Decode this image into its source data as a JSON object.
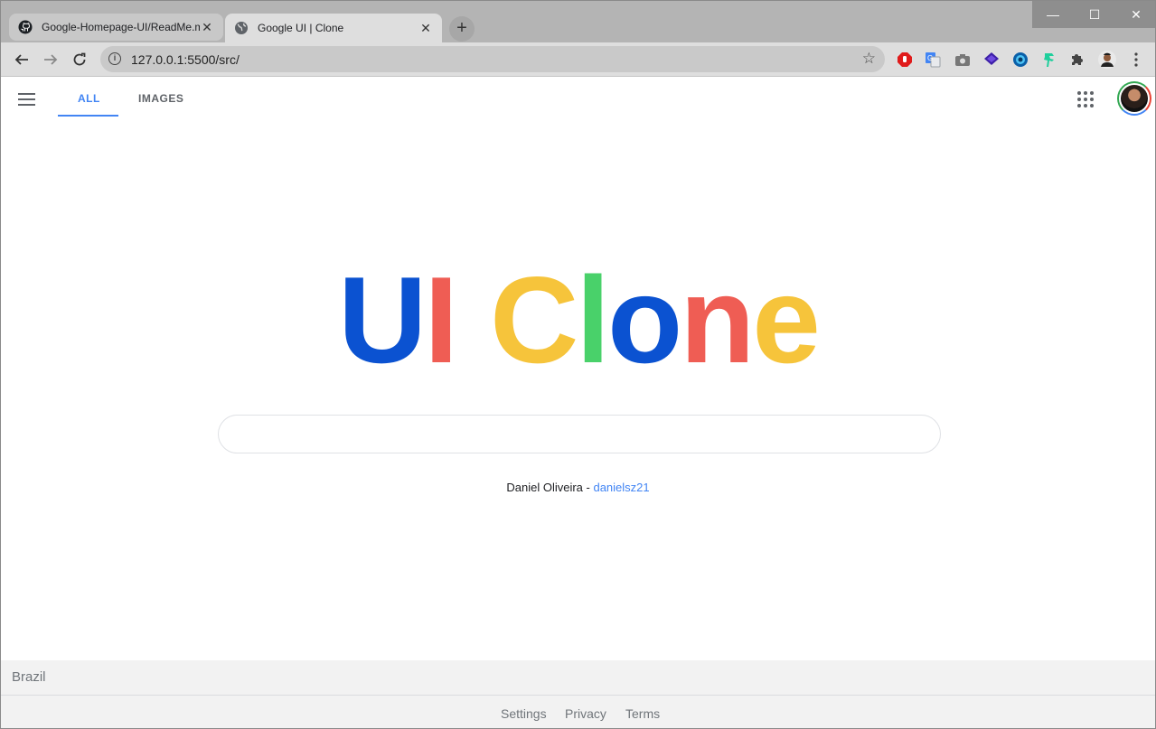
{
  "browser": {
    "tabs": [
      {
        "title": "Google-Homepage-UI/ReadMe.m",
        "close": "✕"
      },
      {
        "title": "Google UI | Clone",
        "close": "✕"
      }
    ],
    "new_tab": "+",
    "window_controls": {
      "minimize": "—",
      "maximize": "☐",
      "close": "✕"
    },
    "address": "127.0.0.1:5500/src/",
    "extension_icons": [
      "adblock-icon",
      "translate-icon",
      "camera-icon",
      "layers-icon",
      "eye-icon",
      "dino-icon",
      "puzzle-icon",
      "profile-icon",
      "menu-icon"
    ]
  },
  "header": {
    "tabs": [
      {
        "label": "ALL",
        "active": true
      },
      {
        "label": "IMAGES",
        "active": false
      }
    ]
  },
  "logo": {
    "letters": [
      {
        "char": "U",
        "color": "#0b52d1"
      },
      {
        "char": "I",
        "color": "#ef5d54"
      },
      {
        "char": "C",
        "color": "#f6c43b"
      },
      {
        "char": "l",
        "color": "#49d16a"
      },
      {
        "char": "o",
        "color": "#0b52d1"
      },
      {
        "char": "n",
        "color": "#ef5d54"
      },
      {
        "char": "e",
        "color": "#f6c43b"
      }
    ]
  },
  "search": {
    "value": "",
    "placeholder": ""
  },
  "credit": {
    "author": "Daniel Oliveira - ",
    "handle": "danielsz21"
  },
  "footer": {
    "country": "Brazil",
    "links": [
      "Settings",
      "Privacy",
      "Terms"
    ]
  },
  "colors": {
    "accent": "#4285f4",
    "muted": "#70757a"
  }
}
